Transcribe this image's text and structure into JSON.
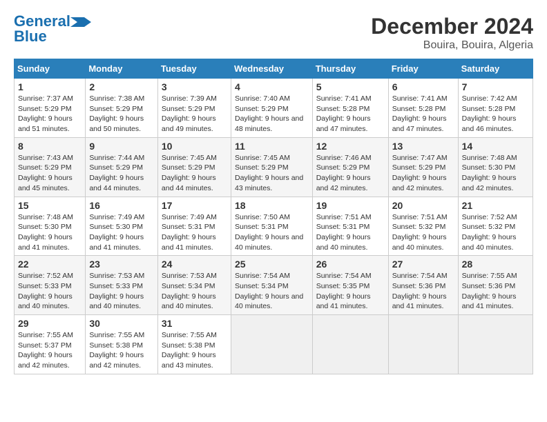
{
  "logo": {
    "line1": "General",
    "line2": "Blue"
  },
  "title": "December 2024",
  "subtitle": "Bouira, Bouira, Algeria",
  "weekdays": [
    "Sunday",
    "Monday",
    "Tuesday",
    "Wednesday",
    "Thursday",
    "Friday",
    "Saturday"
  ],
  "weeks": [
    [
      {
        "day": 1,
        "sunrise": "7:37 AM",
        "sunset": "5:29 PM",
        "daylight": "9 hours and 51 minutes."
      },
      {
        "day": 2,
        "sunrise": "7:38 AM",
        "sunset": "5:29 PM",
        "daylight": "9 hours and 50 minutes."
      },
      {
        "day": 3,
        "sunrise": "7:39 AM",
        "sunset": "5:29 PM",
        "daylight": "9 hours and 49 minutes."
      },
      {
        "day": 4,
        "sunrise": "7:40 AM",
        "sunset": "5:29 PM",
        "daylight": "9 hours and 48 minutes."
      },
      {
        "day": 5,
        "sunrise": "7:41 AM",
        "sunset": "5:28 PM",
        "daylight": "9 hours and 47 minutes."
      },
      {
        "day": 6,
        "sunrise": "7:41 AM",
        "sunset": "5:28 PM",
        "daylight": "9 hours and 47 minutes."
      },
      {
        "day": 7,
        "sunrise": "7:42 AM",
        "sunset": "5:28 PM",
        "daylight": "9 hours and 46 minutes."
      }
    ],
    [
      {
        "day": 8,
        "sunrise": "7:43 AM",
        "sunset": "5:29 PM",
        "daylight": "9 hours and 45 minutes."
      },
      {
        "day": 9,
        "sunrise": "7:44 AM",
        "sunset": "5:29 PM",
        "daylight": "9 hours and 44 minutes."
      },
      {
        "day": 10,
        "sunrise": "7:45 AM",
        "sunset": "5:29 PM",
        "daylight": "9 hours and 44 minutes."
      },
      {
        "day": 11,
        "sunrise": "7:45 AM",
        "sunset": "5:29 PM",
        "daylight": "9 hours and 43 minutes."
      },
      {
        "day": 12,
        "sunrise": "7:46 AM",
        "sunset": "5:29 PM",
        "daylight": "9 hours and 42 minutes."
      },
      {
        "day": 13,
        "sunrise": "7:47 AM",
        "sunset": "5:29 PM",
        "daylight": "9 hours and 42 minutes."
      },
      {
        "day": 14,
        "sunrise": "7:48 AM",
        "sunset": "5:30 PM",
        "daylight": "9 hours and 42 minutes."
      }
    ],
    [
      {
        "day": 15,
        "sunrise": "7:48 AM",
        "sunset": "5:30 PM",
        "daylight": "9 hours and 41 minutes."
      },
      {
        "day": 16,
        "sunrise": "7:49 AM",
        "sunset": "5:30 PM",
        "daylight": "9 hours and 41 minutes."
      },
      {
        "day": 17,
        "sunrise": "7:49 AM",
        "sunset": "5:31 PM",
        "daylight": "9 hours and 41 minutes."
      },
      {
        "day": 18,
        "sunrise": "7:50 AM",
        "sunset": "5:31 PM",
        "daylight": "9 hours and 40 minutes."
      },
      {
        "day": 19,
        "sunrise": "7:51 AM",
        "sunset": "5:31 PM",
        "daylight": "9 hours and 40 minutes."
      },
      {
        "day": 20,
        "sunrise": "7:51 AM",
        "sunset": "5:32 PM",
        "daylight": "9 hours and 40 minutes."
      },
      {
        "day": 21,
        "sunrise": "7:52 AM",
        "sunset": "5:32 PM",
        "daylight": "9 hours and 40 minutes."
      }
    ],
    [
      {
        "day": 22,
        "sunrise": "7:52 AM",
        "sunset": "5:33 PM",
        "daylight": "9 hours and 40 minutes."
      },
      {
        "day": 23,
        "sunrise": "7:53 AM",
        "sunset": "5:33 PM",
        "daylight": "9 hours and 40 minutes."
      },
      {
        "day": 24,
        "sunrise": "7:53 AM",
        "sunset": "5:34 PM",
        "daylight": "9 hours and 40 minutes."
      },
      {
        "day": 25,
        "sunrise": "7:54 AM",
        "sunset": "5:34 PM",
        "daylight": "9 hours and 40 minutes."
      },
      {
        "day": 26,
        "sunrise": "7:54 AM",
        "sunset": "5:35 PM",
        "daylight": "9 hours and 41 minutes."
      },
      {
        "day": 27,
        "sunrise": "7:54 AM",
        "sunset": "5:36 PM",
        "daylight": "9 hours and 41 minutes."
      },
      {
        "day": 28,
        "sunrise": "7:55 AM",
        "sunset": "5:36 PM",
        "daylight": "9 hours and 41 minutes."
      }
    ],
    [
      {
        "day": 29,
        "sunrise": "7:55 AM",
        "sunset": "5:37 PM",
        "daylight": "9 hours and 42 minutes."
      },
      {
        "day": 30,
        "sunrise": "7:55 AM",
        "sunset": "5:38 PM",
        "daylight": "9 hours and 42 minutes."
      },
      {
        "day": 31,
        "sunrise": "7:55 AM",
        "sunset": "5:38 PM",
        "daylight": "9 hours and 43 minutes."
      },
      null,
      null,
      null,
      null
    ]
  ]
}
